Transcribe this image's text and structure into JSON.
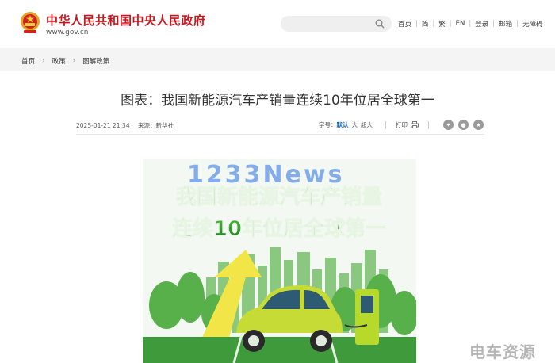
{
  "header": {
    "site_title": "中华人民共和国中央人民政府",
    "site_domain": "www.gov.cn",
    "search_placeholder": "",
    "nav": [
      "首页",
      "简",
      "繁",
      "EN",
      "登录",
      "邮箱",
      "无障碍"
    ]
  },
  "breadcrumb": [
    "首页",
    "政策",
    "图解政策"
  ],
  "article": {
    "title": "图表：我国新能源汽车产销量连续10年位居全球第一",
    "date": "2025-01-21 21:34",
    "source_label": "来源：",
    "source": "新华社",
    "font_size_label": "字号：",
    "font_sizes": [
      "默认",
      "大",
      "超大"
    ],
    "print_label": "打印"
  },
  "poster": {
    "line1": "我国新能源汽车产销量",
    "line2": "连续10年位居全球第一"
  },
  "watermarks": {
    "center": "1233News",
    "corner": "电车资源"
  },
  "colors": {
    "brand_red": "#c8161d",
    "accent_blue": "#1565c0",
    "poster_green": "#2e9a2f"
  }
}
